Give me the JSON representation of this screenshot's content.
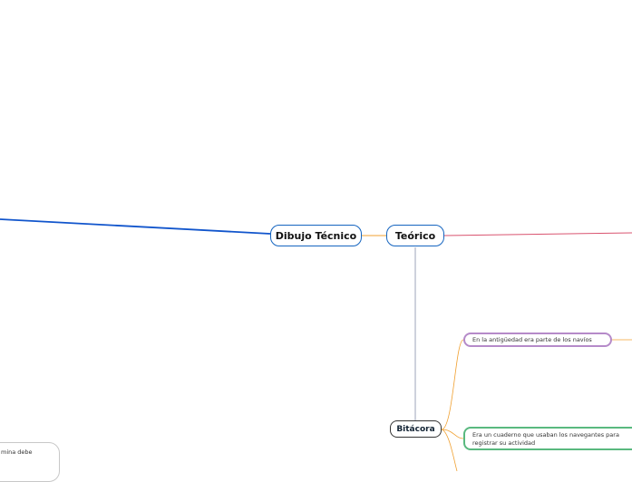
{
  "nodes": {
    "dibujo": "Dibujo Técnico",
    "teorico": "Teórico",
    "bitacora": "Bitácora",
    "antiguedad": "En la antigüedad era parte de los navíos",
    "cuaderno_line1": "Era un cuaderno que usaban los navegantes para",
    "cuaderno_line2": "registrar su actividad",
    "lamina": "mina debe"
  },
  "colors": {
    "blue_link": "#1155cc",
    "orange_link": "#f0a030",
    "red_link": "#d9536f",
    "gray_link": "#9ea3b8",
    "purple": "#b58ac9",
    "green": "#59b97f"
  }
}
